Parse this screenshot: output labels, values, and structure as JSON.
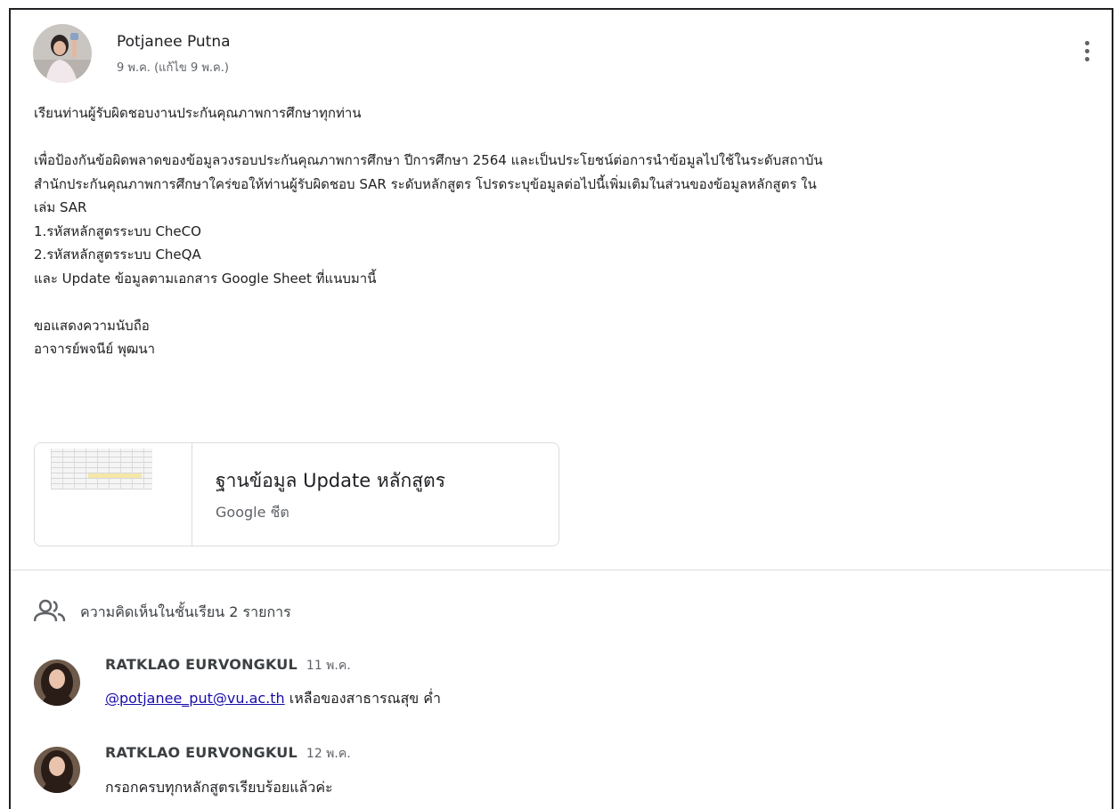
{
  "post": {
    "author": "Potjanee Putna",
    "date": "9 พ.ค. (แก้ไข 9 พ.ค.)",
    "body": [
      "เรียนท่านผู้รับผิดชอบงานประกันคุณภาพการศึกษาทุกท่าน",
      "",
      "เพื่อป้องกันข้อผิดพลาดของข้อมูลวงรอบประกันคุณภาพการศึกษา ปีการศึกษา 2564 และเป็นประโยชน์ต่อการนำข้อมูลไปใช้ในระดับสถาบัน",
      "สำนักประกันคุณภาพการศึกษาใคร่ขอให้ท่านผู้รับผิดชอบ SAR ระดับหลักสูตร โปรดระบุข้อมูลต่อไปนี้เพิ่มเติมในส่วนของข้อมูลหลักสูตร ใน",
      "เล่ม SAR",
      "1.รหัสหลักสูตรระบบ CheCO",
      "2.รหัสหลักสูตรระบบ CheQA",
      "และ Update ข้อมูลตามเอกสาร Google Sheet ที่แนบมานี้",
      "",
      "ขอแสดงความนับถือ",
      "อาจารย์พจนีย์  พุฒนา"
    ],
    "attachment": {
      "title": "ฐานข้อมูล Update หลักสูตร",
      "type": "Google ชีต"
    },
    "more_icon": "more-vert-icon"
  },
  "comments_section": {
    "label": "ความคิดเห็นในชั้นเรียน 2 รายการ",
    "icon": "people-icon"
  },
  "comments": [
    {
      "author": "RATKLAO EURVONGKUL",
      "date": "11 พ.ค.",
      "mention": "@potjanee_put@vu.ac.th",
      "text": " เหลือของสาธารณสุข ค่ำ"
    },
    {
      "author": "RATKLAO EURVONGKUL",
      "date": "12 พ.ค.",
      "text": "กรอกครบทุกหลักสูตรเรียบร้อยแล้วค่ะ"
    }
  ],
  "colors": {
    "link": "#1a0dab",
    "divider": "#dadce0",
    "muted": "#5f6368"
  }
}
